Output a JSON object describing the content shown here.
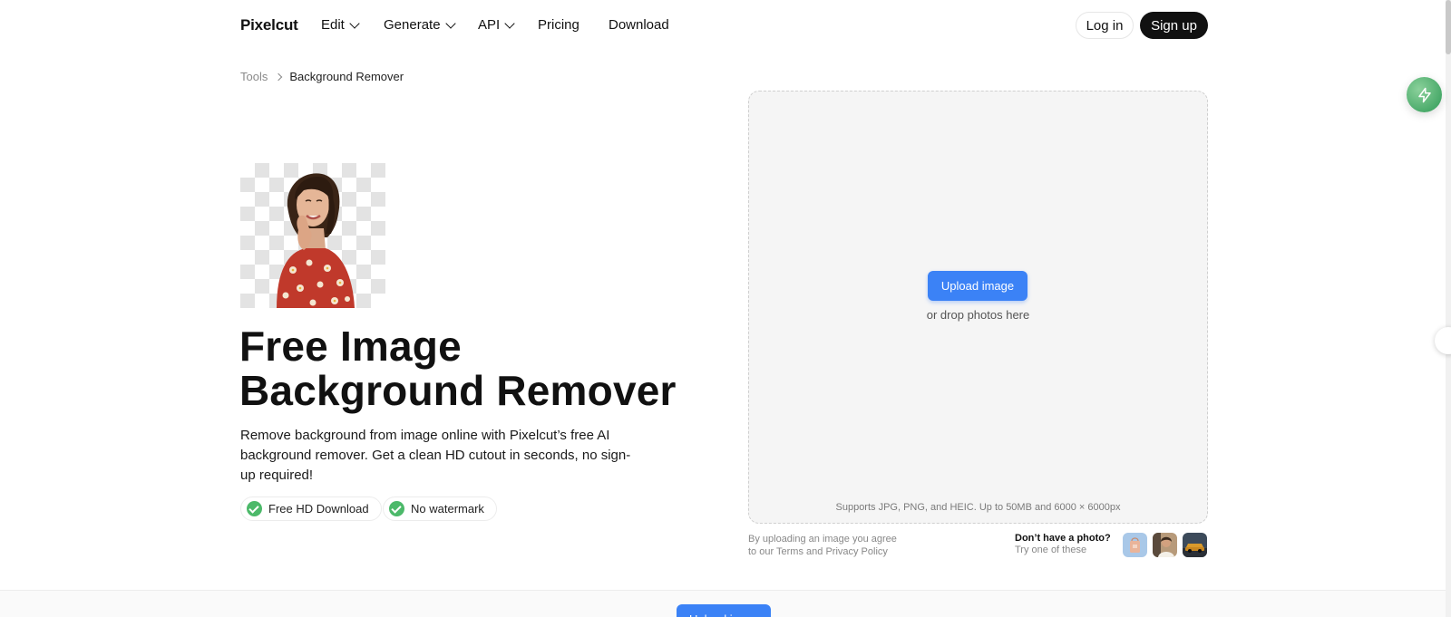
{
  "nav": {
    "logo": "Pixelcut",
    "items": [
      {
        "label": "Edit",
        "dropdown": true
      },
      {
        "label": "Generate",
        "dropdown": true
      },
      {
        "label": "API",
        "dropdown": true
      },
      {
        "label": "Pricing",
        "dropdown": false
      },
      {
        "label": "Download",
        "dropdown": false
      }
    ],
    "login": "Log in",
    "signup": "Sign up"
  },
  "breadcrumb": {
    "parent": "Tools",
    "current": "Background Remover"
  },
  "hero": {
    "title_line1": "Free Image",
    "title_line2": "Background Remover",
    "description": "Remove background from image online with Pixelcut’s free AI background remover. Get a clean HD cutout in seconds, no sign-up required!",
    "features": [
      "Free HD Download",
      "No watermark"
    ]
  },
  "upload": {
    "button": "Upload image",
    "drop_text": "or drop photos here",
    "supports": "Supports JPG, PNG, and HEIC. Up to 50MB and 6000 × 6000px",
    "agree_prefix": "By uploading an image you agree",
    "agree_to": "to our",
    "terms": "Terms",
    "and": "and",
    "privacy": "Privacy Policy",
    "no_photo_title": "Don’t have a photo?",
    "no_photo_sub": "Try one of these"
  },
  "bottom": {
    "button": "Upload image"
  },
  "colors": {
    "accent": "#3b82f6",
    "check": "#4cb96a",
    "fab": "#2f9a56",
    "dark_button": "#111111"
  }
}
